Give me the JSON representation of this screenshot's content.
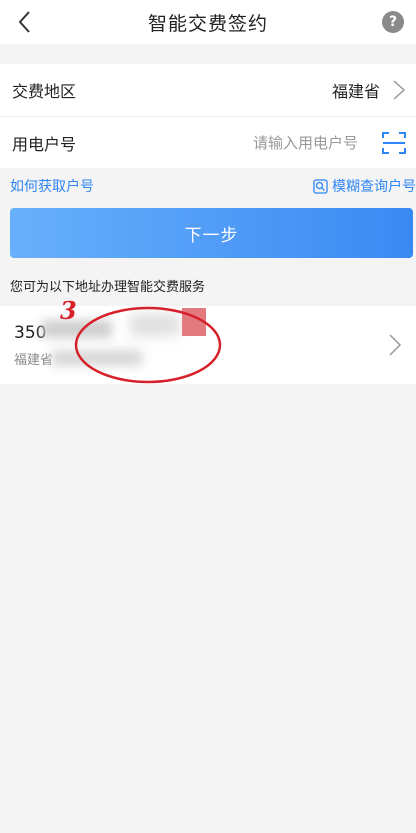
{
  "header": {
    "title": "智能交费签约",
    "help_label": "?"
  },
  "form": {
    "region_label": "交费地区",
    "region_value": "福建省",
    "account_label": "用电户号",
    "account_placeholder": "请输入用电户号",
    "account_value": ""
  },
  "links": {
    "how_to_get": "如何获取户号",
    "fuzzy_search": "模糊查询户号"
  },
  "next_button": "下一步",
  "hint": "您可为以下地址办理智能交费服务",
  "address_card": {
    "account_number": "350",
    "address": "福建省"
  },
  "annotation": {
    "number": "3",
    "color": "#d8202a"
  },
  "colors": {
    "link": "#2f86f6",
    "button_start": "#68b0fb",
    "button_end": "#3a89f3"
  }
}
